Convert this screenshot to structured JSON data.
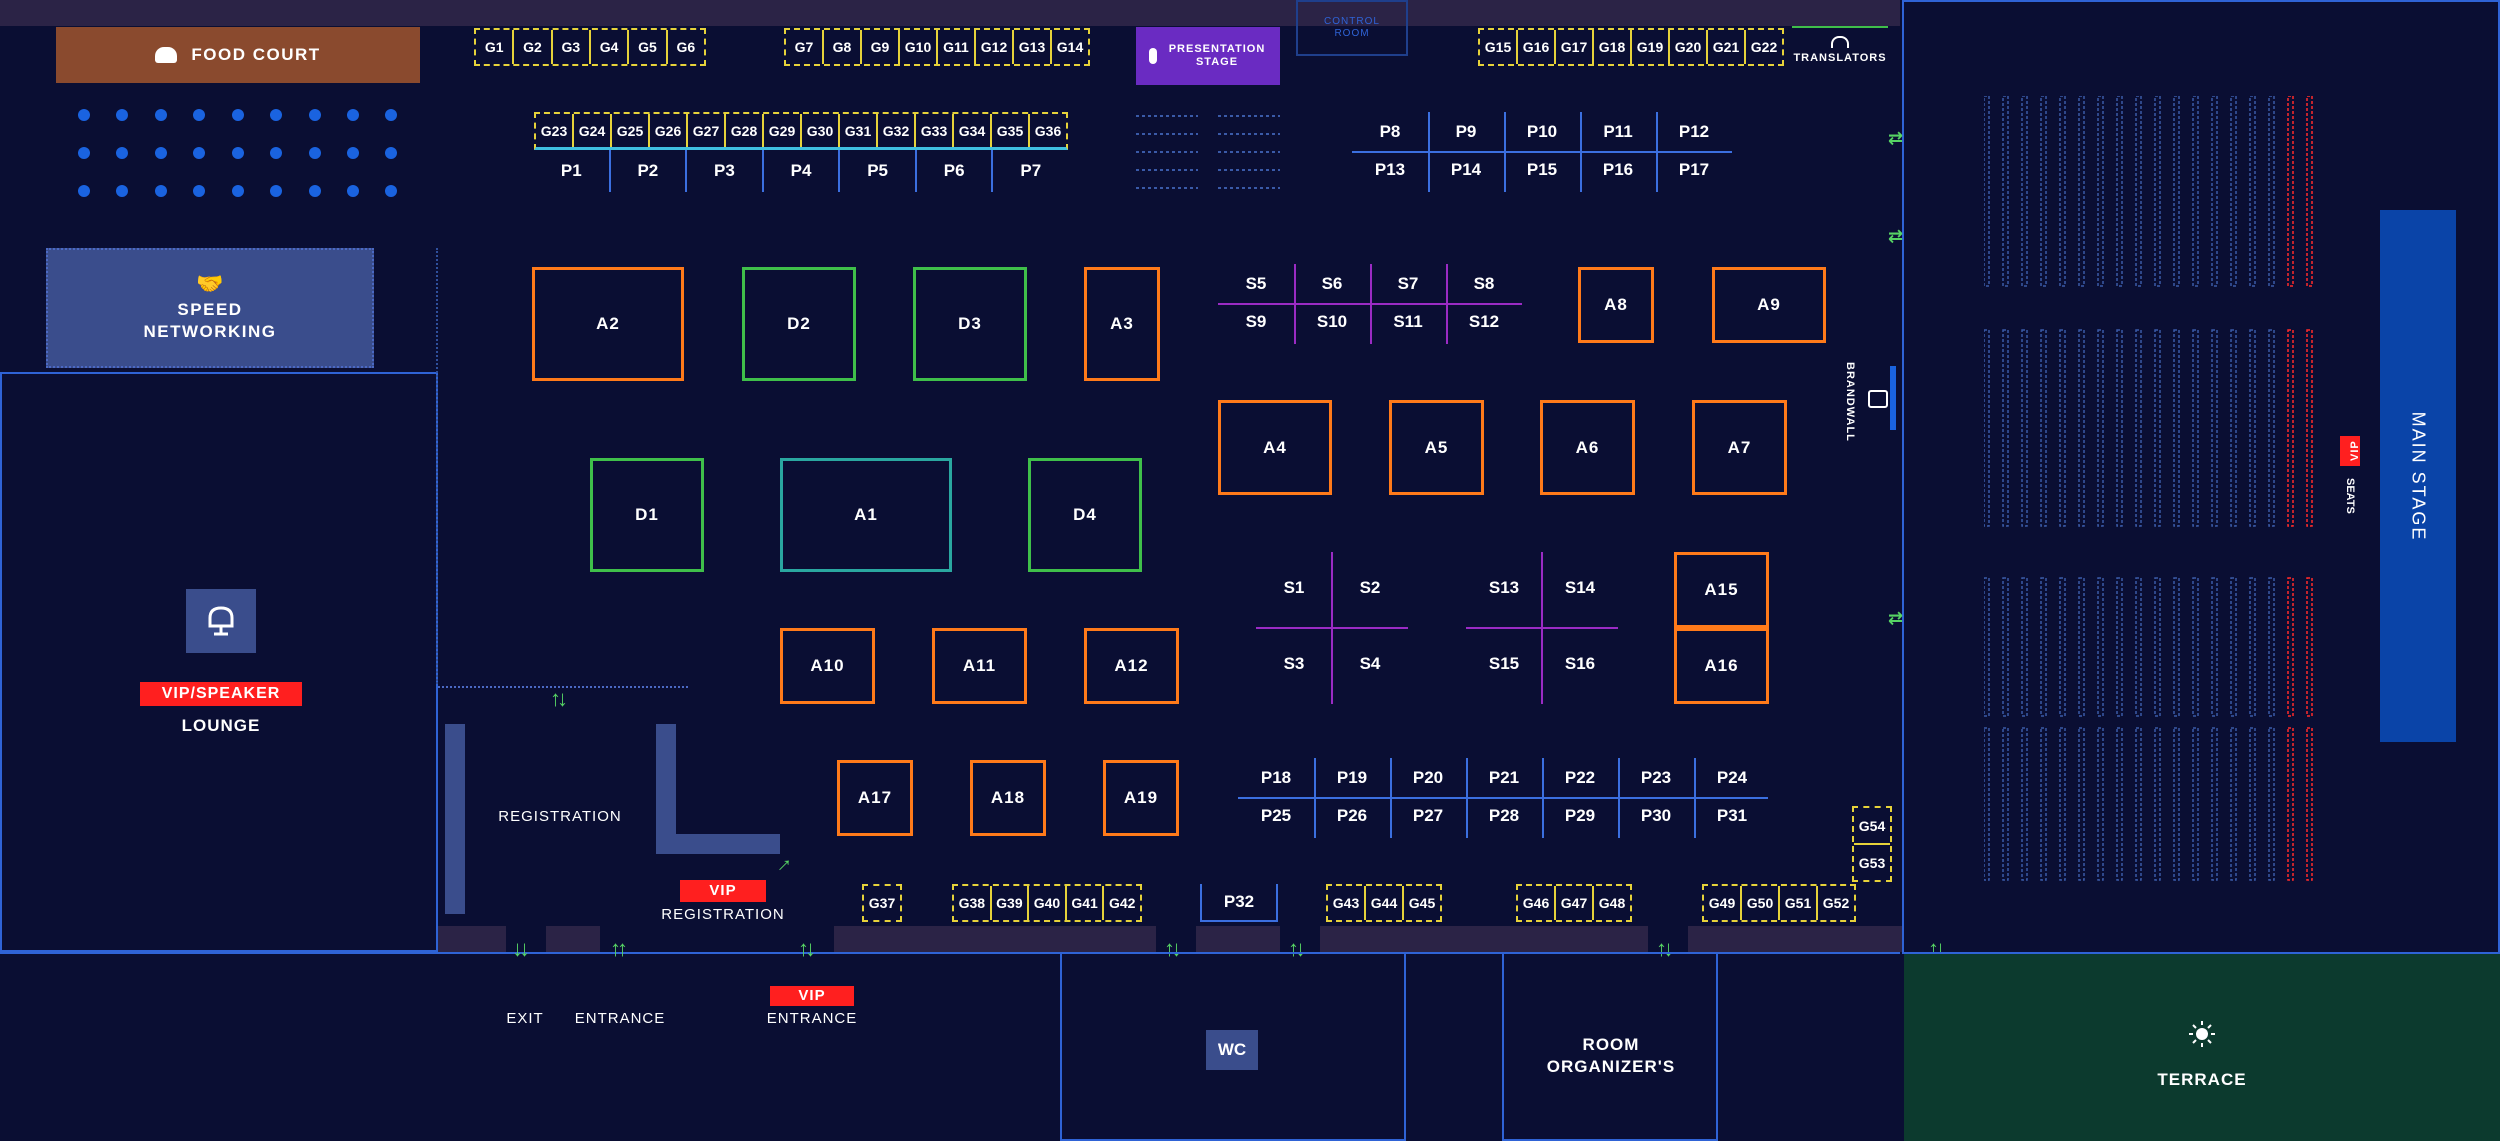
{
  "areas": {
    "food_court": "FOOD COURT",
    "speed_networking": "SPEED NETWORKING",
    "lounge_tag": "VIP/SPEAKER",
    "lounge": "LOUNGE",
    "registration": "REGISTRATION",
    "vip_registration_tag": "VIP",
    "vip_registration": "REGISTRATION",
    "exit": "EXIT",
    "entrance": "ENTRANCE",
    "vip_entrance_tag": "VIP",
    "vip_entrance": "ENTRANCE",
    "wc": "WC",
    "room_organizers": "ROOM ORGANIZER'S",
    "terrace": "TERRACE",
    "main_stage": "MAIN STAGE",
    "vip_seats_tag": "VIP",
    "vip_seats": "SEATS",
    "brandwall": "BRANDWALL",
    "presentation_stage": "PRESENTATION STAGE",
    "control_room": "CONTROL ROOM",
    "translators": "TRANSLATORS"
  },
  "booths": {
    "A1": "A1",
    "A2": "A2",
    "A3": "A3",
    "A4": "A4",
    "A5": "A5",
    "A6": "A6",
    "A7": "A7",
    "A8": "A8",
    "A9": "A9",
    "A10": "A10",
    "A11": "A11",
    "A12": "A12",
    "A15": "A15",
    "A16": "A16",
    "A17": "A17",
    "A18": "A18",
    "A19": "A19",
    "D1": "D1",
    "D2": "D2",
    "D3": "D3",
    "D4": "D4"
  },
  "g_top_1": [
    "G1",
    "G2",
    "G3",
    "G4",
    "G5",
    "G6"
  ],
  "g_top_2": [
    "G7",
    "G8",
    "G9",
    "G10",
    "G11",
    "G12",
    "G13",
    "G14"
  ],
  "g_top_3": [
    "G15",
    "G16",
    "G17",
    "G18",
    "G19",
    "G20",
    "G21",
    "G22"
  ],
  "g_row_2": [
    "G23",
    "G24",
    "G25",
    "G26",
    "G27",
    "G28",
    "G29",
    "G30",
    "G31",
    "G32",
    "G33",
    "G34",
    "G35",
    "G36"
  ],
  "g_bottom": {
    "g37": "G37",
    "group1": [
      "G38",
      "G39",
      "G40",
      "G41",
      "G42"
    ],
    "group2": [
      "G43",
      "G44",
      "G45"
    ],
    "group3": [
      "G46",
      "G47",
      "G48"
    ],
    "group4": [
      "G49",
      "G50",
      "G51",
      "G52"
    ],
    "side": [
      "G54",
      "G53"
    ]
  },
  "p_top_left": [
    "P1",
    "P2",
    "P3",
    "P4",
    "P5",
    "P6",
    "P7"
  ],
  "p_top_right_upper": [
    "P8",
    "P9",
    "P10",
    "P11",
    "P12"
  ],
  "p_top_right_lower": [
    "P13",
    "P14",
    "P15",
    "P16",
    "P17"
  ],
  "p_bottom_upper": [
    "P18",
    "P19",
    "P20",
    "P21",
    "P22",
    "P23",
    "P24"
  ],
  "p_bottom_lower": [
    "P25",
    "P26",
    "P27",
    "P28",
    "P29",
    "P30",
    "P31"
  ],
  "p32": "P32",
  "s_top_upper": [
    "S5",
    "S6",
    "S7",
    "S8"
  ],
  "s_top_lower": [
    "S9",
    "S10",
    "S11",
    "S12"
  ],
  "s_cross_1": [
    "S1",
    "S2",
    "S3",
    "S4"
  ],
  "s_cross_2": [
    "S13",
    "S14",
    "S15",
    "S16"
  ],
  "colors": {
    "background": "#0a0e33",
    "wall_line": "#2f63d6",
    "booth_orange": "#ff7a1a",
    "booth_green": "#3fbf4a",
    "booth_teal": "#2aa7a0",
    "seminar_purple": "#9a2bc4",
    "g_yellow": "#e6d23a",
    "vip_red": "#ff1f1f",
    "food_court": "#8a4a2e",
    "terrace": "#0c3a2e",
    "main_stage": "#0a44a8",
    "speed_networking": "#3a4d8c",
    "presentation_stage": "#6a2bc2"
  },
  "icons": [
    "burger-icon",
    "handshake-icon",
    "armchair-icon",
    "microphone-icon",
    "headphones-icon",
    "camera-icon",
    "sun-icon",
    "arrow-icon"
  ]
}
